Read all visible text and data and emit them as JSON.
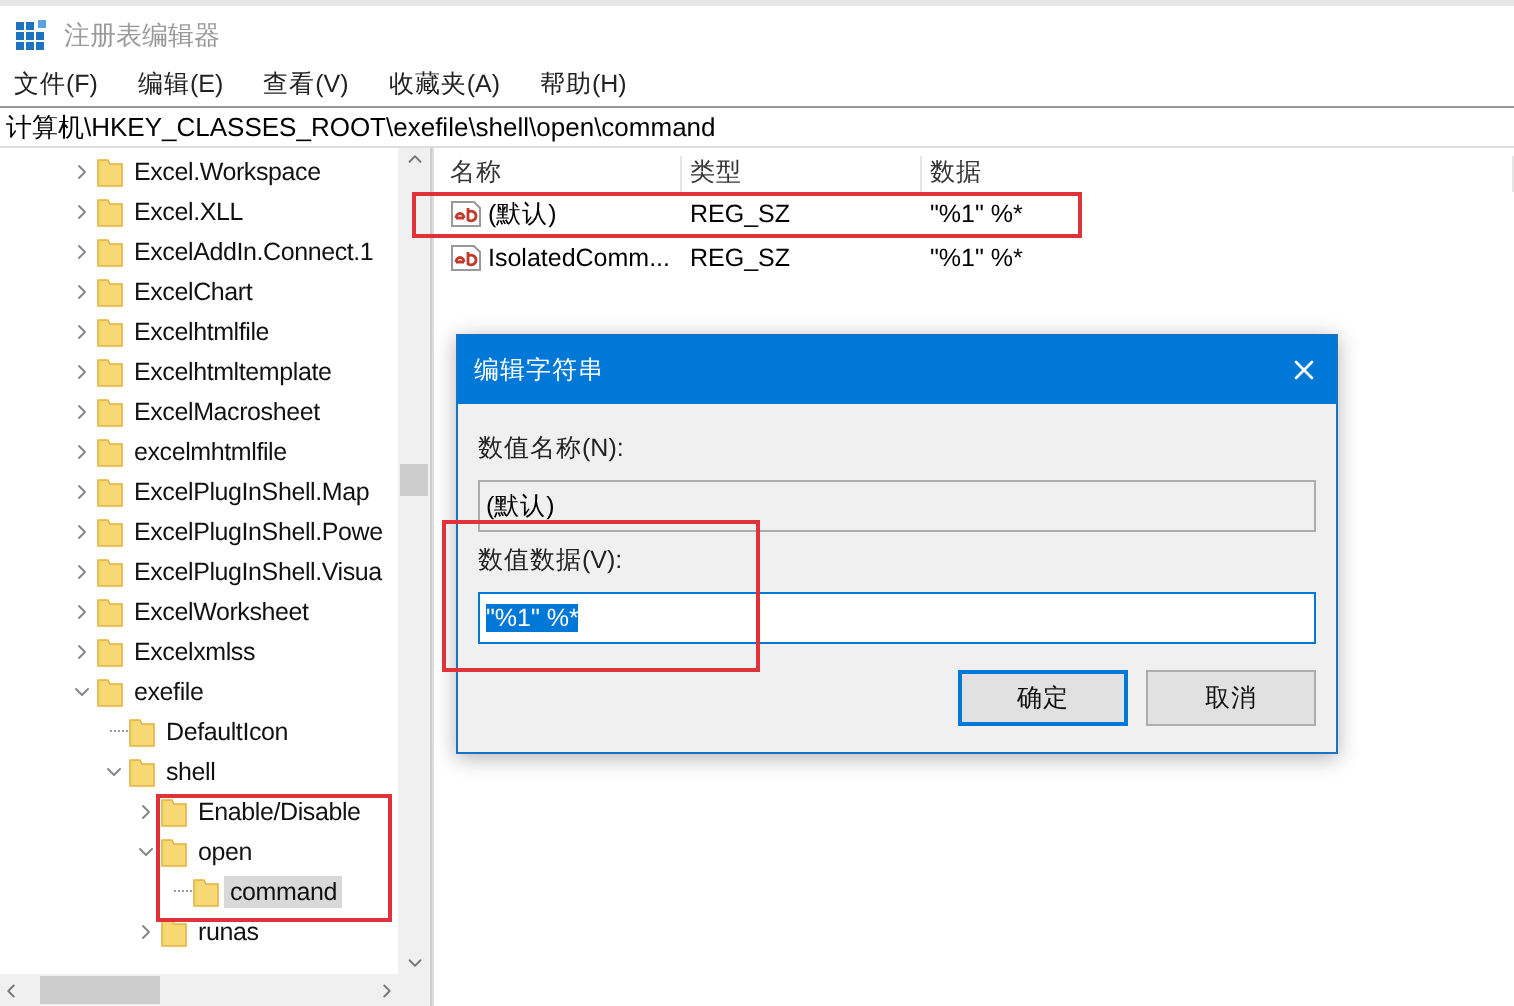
{
  "window": {
    "title": "注册表编辑器"
  },
  "menu": [
    {
      "label": "文件(F)"
    },
    {
      "label": "编辑(E)"
    },
    {
      "label": "查看(V)"
    },
    {
      "label": "收藏夹(A)"
    },
    {
      "label": "帮助(H)"
    }
  ],
  "address_bar": {
    "path": "计算机\\HKEY_CLASSES_ROOT\\exefile\\shell\\open\\command"
  },
  "tree": [
    {
      "label": "Excel.Workspace",
      "kind": "branch",
      "expanded": false,
      "selected": false
    },
    {
      "label": "Excel.XLL",
      "kind": "branch",
      "expanded": false,
      "selected": false
    },
    {
      "label": "ExcelAddIn.Connect.1",
      "kind": "branch",
      "expanded": false,
      "selected": false
    },
    {
      "label": "ExcelChart",
      "kind": "branch",
      "expanded": false,
      "selected": false
    },
    {
      "label": "Excelhtmlfile",
      "kind": "branch",
      "expanded": false,
      "selected": false
    },
    {
      "label": "Excelhtmltemplate",
      "kind": "branch",
      "expanded": false,
      "selected": false
    },
    {
      "label": "ExcelMacrosheet",
      "kind": "branch",
      "expanded": false,
      "selected": false
    },
    {
      "label": "excelmhtmlfile",
      "kind": "branch",
      "expanded": false,
      "selected": false
    },
    {
      "label": "ExcelPlugInShell.Map",
      "kind": "branch",
      "expanded": false,
      "selected": false
    },
    {
      "label": "ExcelPlugInShell.Powe",
      "kind": "branch",
      "expanded": false,
      "selected": false
    },
    {
      "label": "ExcelPlugInShell.Visua",
      "kind": "branch",
      "expanded": false,
      "selected": false
    },
    {
      "label": "ExcelWorksheet",
      "kind": "branch",
      "expanded": false,
      "selected": false
    },
    {
      "label": "Excelxmlss",
      "kind": "branch",
      "expanded": false,
      "selected": false
    },
    {
      "label": "exefile",
      "kind": "branch",
      "expanded": true,
      "selected": false,
      "children": [
        {
          "label": "DefaultIcon",
          "kind": "leaf",
          "selected": false
        },
        {
          "label": "shell",
          "kind": "branch",
          "expanded": true,
          "selected": false,
          "children": [
            {
              "label": "Enable/Disable",
              "kind": "branch",
              "expanded": false,
              "selected": false
            },
            {
              "label": "open",
              "kind": "branch",
              "expanded": true,
              "selected": false,
              "children": [
                {
                  "label": "command",
                  "kind": "leaf",
                  "selected": true
                }
              ]
            },
            {
              "label": "runas",
              "kind": "branch",
              "expanded": false,
              "selected": false
            }
          ]
        }
      ]
    }
  ],
  "values": {
    "columns": [
      "名称",
      "类型",
      "数据"
    ],
    "rows": [
      {
        "name": "(默认)",
        "type": "REG_SZ",
        "data": "\"%1\" %*"
      },
      {
        "name": "IsolatedComm...",
        "type": "REG_SZ",
        "data": "\"%1\" %*"
      }
    ]
  },
  "dialog": {
    "title": "编辑字符串",
    "name_label": "数值名称(N):",
    "name_value": "(默认)",
    "data_label": "数值数据(V):",
    "data_value": "\"%1\" %*",
    "data_value_selected": true,
    "buttons": [
      {
        "label": "确定",
        "default": true
      },
      {
        "label": "取消",
        "default": false
      }
    ]
  }
}
